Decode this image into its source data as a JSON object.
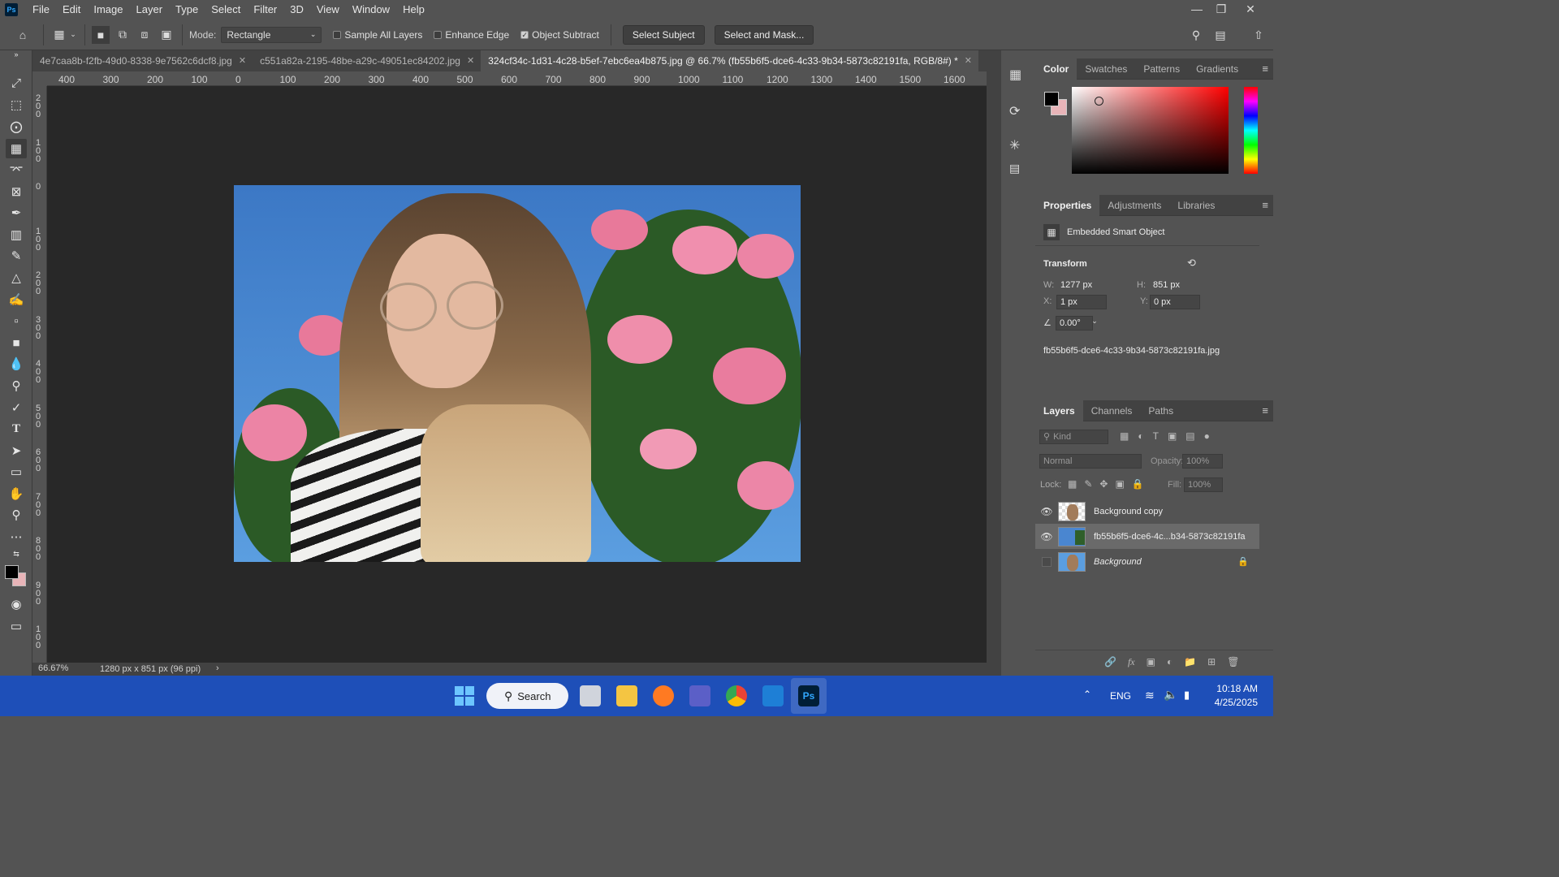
{
  "app": {
    "logo": "Ps",
    "menu": [
      "File",
      "Edit",
      "Image",
      "Layer",
      "Type",
      "Select",
      "Filter",
      "3D",
      "View",
      "Window",
      "Help"
    ]
  },
  "options": {
    "mode_label": "Mode:",
    "mode_value": "Rectangle",
    "sample_all_layers": "Sample All Layers",
    "enhance_edge": "Enhance Edge",
    "object_subtract": "Object Subtract",
    "object_subtract_checked": true,
    "select_subject": "Select Subject",
    "select_and_mask": "Select and Mask..."
  },
  "tabs": [
    {
      "label": "4e7caa8b-f2fb-49d0-8338-9e7562c6dcf8.jpg",
      "active": false
    },
    {
      "label": "c551a82a-2195-48be-a29c-49051ec84202.jpg",
      "active": false
    },
    {
      "label": "324cf34c-1d31-4c28-b5ef-7ebc6ea4b875.jpg @ 66.7% (fb55b6f5-dce6-4c33-9b34-5873c82191fa, RGB/8#) *",
      "active": true
    }
  ],
  "rulers": {
    "top": [
      "400",
      "300",
      "200",
      "100",
      "0",
      "100",
      "200",
      "300",
      "400",
      "500",
      "600",
      "700",
      "800",
      "900",
      "1000",
      "1100",
      "1200",
      "1300",
      "1400",
      "1500",
      "1600"
    ],
    "left": [
      "2\n0\n0",
      "1\n0\n0",
      "0",
      "1\n0\n0",
      "2\n0\n0",
      "3\n0\n0",
      "4\n0\n0",
      "5\n0\n0",
      "6\n0\n0",
      "7\n0\n0",
      "8\n0\n0",
      "9\n0\n0",
      "1\n0\n0"
    ]
  },
  "status": {
    "zoom": "66.67%",
    "doc_info": "1280 px x 851 px (96 ppi)",
    "arrow": "›"
  },
  "color_panel": {
    "tabs": [
      "Color",
      "Swatches",
      "Patterns",
      "Gradients"
    ],
    "fg_color": "#000000",
    "bg_color": "#e8b4b8"
  },
  "properties": {
    "tabs": [
      "Properties",
      "Adjustments",
      "Libraries"
    ],
    "type": "Embedded Smart Object",
    "section": "Transform",
    "w_label": "W:",
    "w_value": "1277 px",
    "h_label": "H:",
    "h_value": "851 px",
    "x_label": "X:",
    "x_value": "1 px",
    "y_label": "Y:",
    "y_value": "0 px",
    "angle": "0.00°",
    "filename": "fb55b6f5-dce6-4c33-9b34-5873c82191fa.jpg"
  },
  "layers": {
    "tabs": [
      "Layers",
      "Channels",
      "Paths"
    ],
    "kind_placeholder": "Kind",
    "blend": "Normal",
    "opacity_label": "Opacity:",
    "opacity_value": "100%",
    "lock_label": "Lock:",
    "fill_label": "Fill:",
    "fill_value": "100%",
    "items": [
      {
        "name": "Background copy",
        "visible": true,
        "selected": false
      },
      {
        "name": "fb55b6f5-dce6-4c...b34-5873c82191fa",
        "visible": true,
        "selected": true
      },
      {
        "name": "Background",
        "visible": false,
        "selected": false,
        "locked": true
      }
    ]
  },
  "taskbar": {
    "search_label": "Search",
    "lang": "ENG",
    "time": "10:18 AM",
    "date": "4/25/2025"
  }
}
